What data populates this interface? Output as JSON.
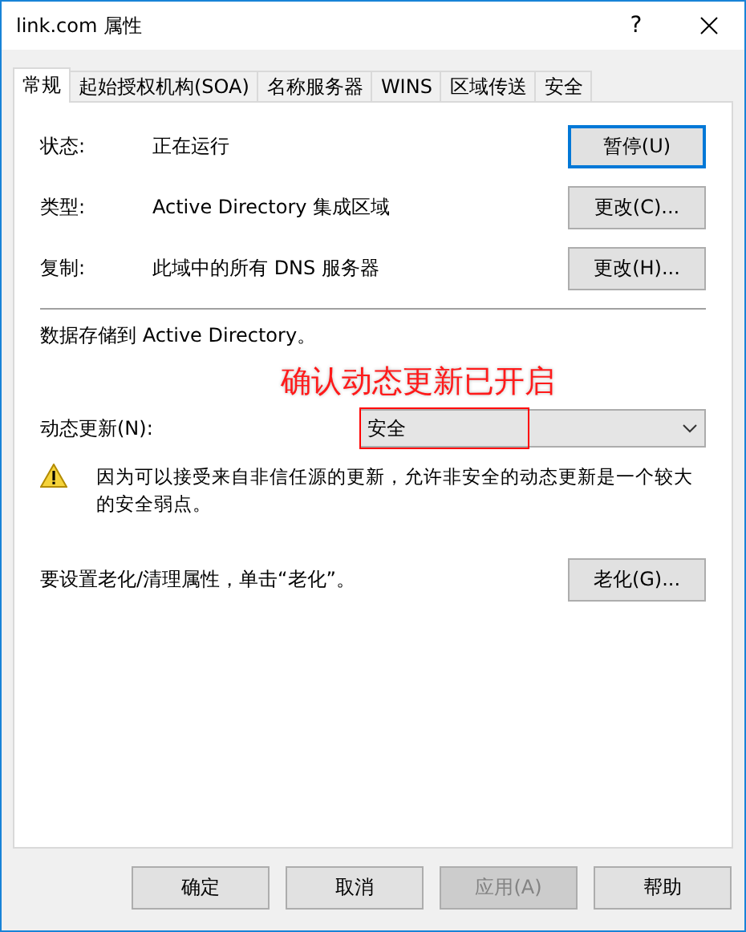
{
  "window": {
    "title": "link.com 属性",
    "help": "?"
  },
  "tabs": [
    {
      "label": "常规",
      "selected": true
    },
    {
      "label": "起始授权机构(SOA)",
      "selected": false
    },
    {
      "label": "名称服务器",
      "selected": false
    },
    {
      "label": "WINS",
      "selected": false
    },
    {
      "label": "区域传送",
      "selected": false
    },
    {
      "label": "安全",
      "selected": false
    }
  ],
  "info_rows": [
    {
      "label": "状态:",
      "value": "正在运行",
      "button": "暂停(U)",
      "focused": true
    },
    {
      "label": "类型:",
      "value": "Active Directory 集成区域",
      "button": "更改(C)...",
      "focused": false
    },
    {
      "label": "复制:",
      "value": "此域中的所有 DNS 服务器",
      "button": "更改(H)...",
      "focused": false
    }
  ],
  "storage_note": "数据存储到 Active Directory。",
  "annotation": "确认动态更新已开启",
  "dynamic_update": {
    "label": "动态更新(N):",
    "value": "安全",
    "highlighted": true
  },
  "warning": "因为可以接受来自非信任源的更新，允许非安全的动态更新是一个较大的安全弱点。",
  "aging": {
    "text": "要设置老化/清理属性，单击“老化”。",
    "button": "老化(G)..."
  },
  "buttons": [
    {
      "label": "确定",
      "disabled": false
    },
    {
      "label": "取消",
      "disabled": false
    },
    {
      "label": "应用(A)",
      "disabled": true
    },
    {
      "label": "帮助",
      "disabled": false
    }
  ]
}
